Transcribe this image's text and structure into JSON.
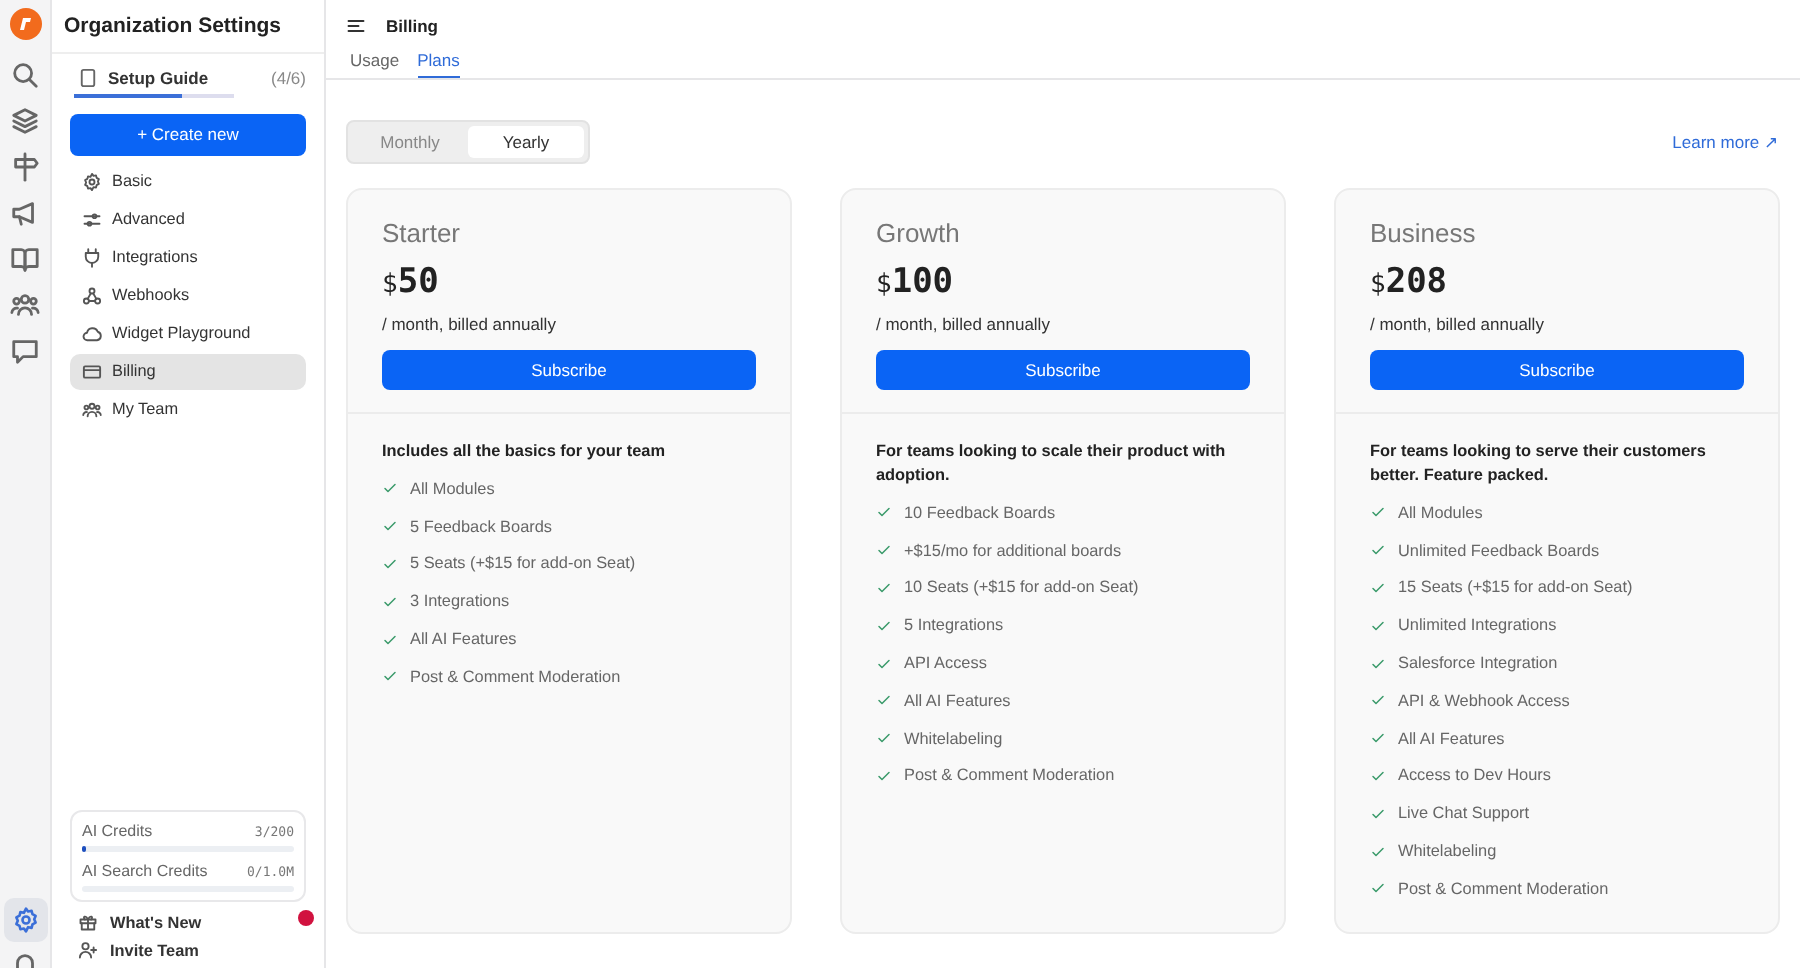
{
  "rail": {
    "bottom_icons": [
      {
        "selected": true
      },
      {
        "selected": false
      }
    ]
  },
  "sidebar": {
    "title": "Organization Settings",
    "setup_guide": {
      "label": "Setup Guide",
      "count": "(4/6)",
      "level": 0.67
    },
    "create_button": {
      "icon": "+",
      "label": "Create new"
    },
    "items": [
      {
        "label": "Basic",
        "selected": false
      },
      {
        "label": "Advanced",
        "selected": false
      },
      {
        "label": "Integrations",
        "selected": false
      },
      {
        "label": "Webhooks",
        "selected": false
      },
      {
        "label": "Widget Playground",
        "selected": false
      },
      {
        "label": "Billing",
        "selected": true
      },
      {
        "label": "My Team",
        "selected": false
      }
    ],
    "credits": [
      {
        "label": "AI Credits",
        "reading": "3/200",
        "level": 0.015
      },
      {
        "label": "AI Search Credits",
        "reading": "0/1.0M",
        "level": 0
      }
    ],
    "footer_items": [
      {
        "label": "What's New",
        "badge": true
      },
      {
        "label": "Invite Team",
        "badge": false
      }
    ]
  },
  "header": {
    "title": "Billing"
  },
  "tabs": [
    {
      "label": "Usage",
      "selected": false
    },
    {
      "label": "Plans",
      "selected": true
    }
  ],
  "billing_toggle": [
    {
      "label": "Monthly",
      "selected": false
    },
    {
      "label": "Yearly",
      "selected": true
    }
  ],
  "learn_more": {
    "label": "Learn more",
    "icon": "↗"
  },
  "plans": [
    {
      "name": "Starter",
      "currency": "$",
      "price": "50",
      "period": "/ month, billed annually",
      "button": "Subscribe",
      "summary": "Includes all the basics for your team",
      "features": [
        "All Modules",
        "5 Feedback Boards",
        "5 Seats (+$15 for add-on Seat)",
        "3 Integrations",
        "All AI Features",
        "Post & Comment Moderation"
      ]
    },
    {
      "name": "Growth",
      "currency": "$",
      "price": "100",
      "period": "/ month, billed annually",
      "button": "Subscribe",
      "summary": "For teams looking to scale their product with adoption.",
      "features": [
        "10 Feedback Boards",
        "+$15/mo for additional boards",
        "10 Seats (+$15 for add-on Seat)",
        "5 Integrations",
        "API Access",
        "All AI Features",
        "Whitelabeling",
        "Post & Comment Moderation"
      ]
    },
    {
      "name": "Business",
      "currency": "$",
      "price": "208",
      "period": "/ month, billed annually",
      "button": "Subscribe",
      "summary": "For teams looking to serve their customers better. Feature packed.",
      "features": [
        "All Modules",
        "Unlimited Feedback Boards",
        "15 Seats (+$15 for add-on Seat)",
        "Unlimited Integrations",
        "Salesforce Integration",
        "API & Webhook Access",
        "All AI Features",
        "Access to Dev Hours",
        "Live Chat Support",
        "Whitelabeling",
        "Post & Comment Moderation"
      ]
    }
  ]
}
